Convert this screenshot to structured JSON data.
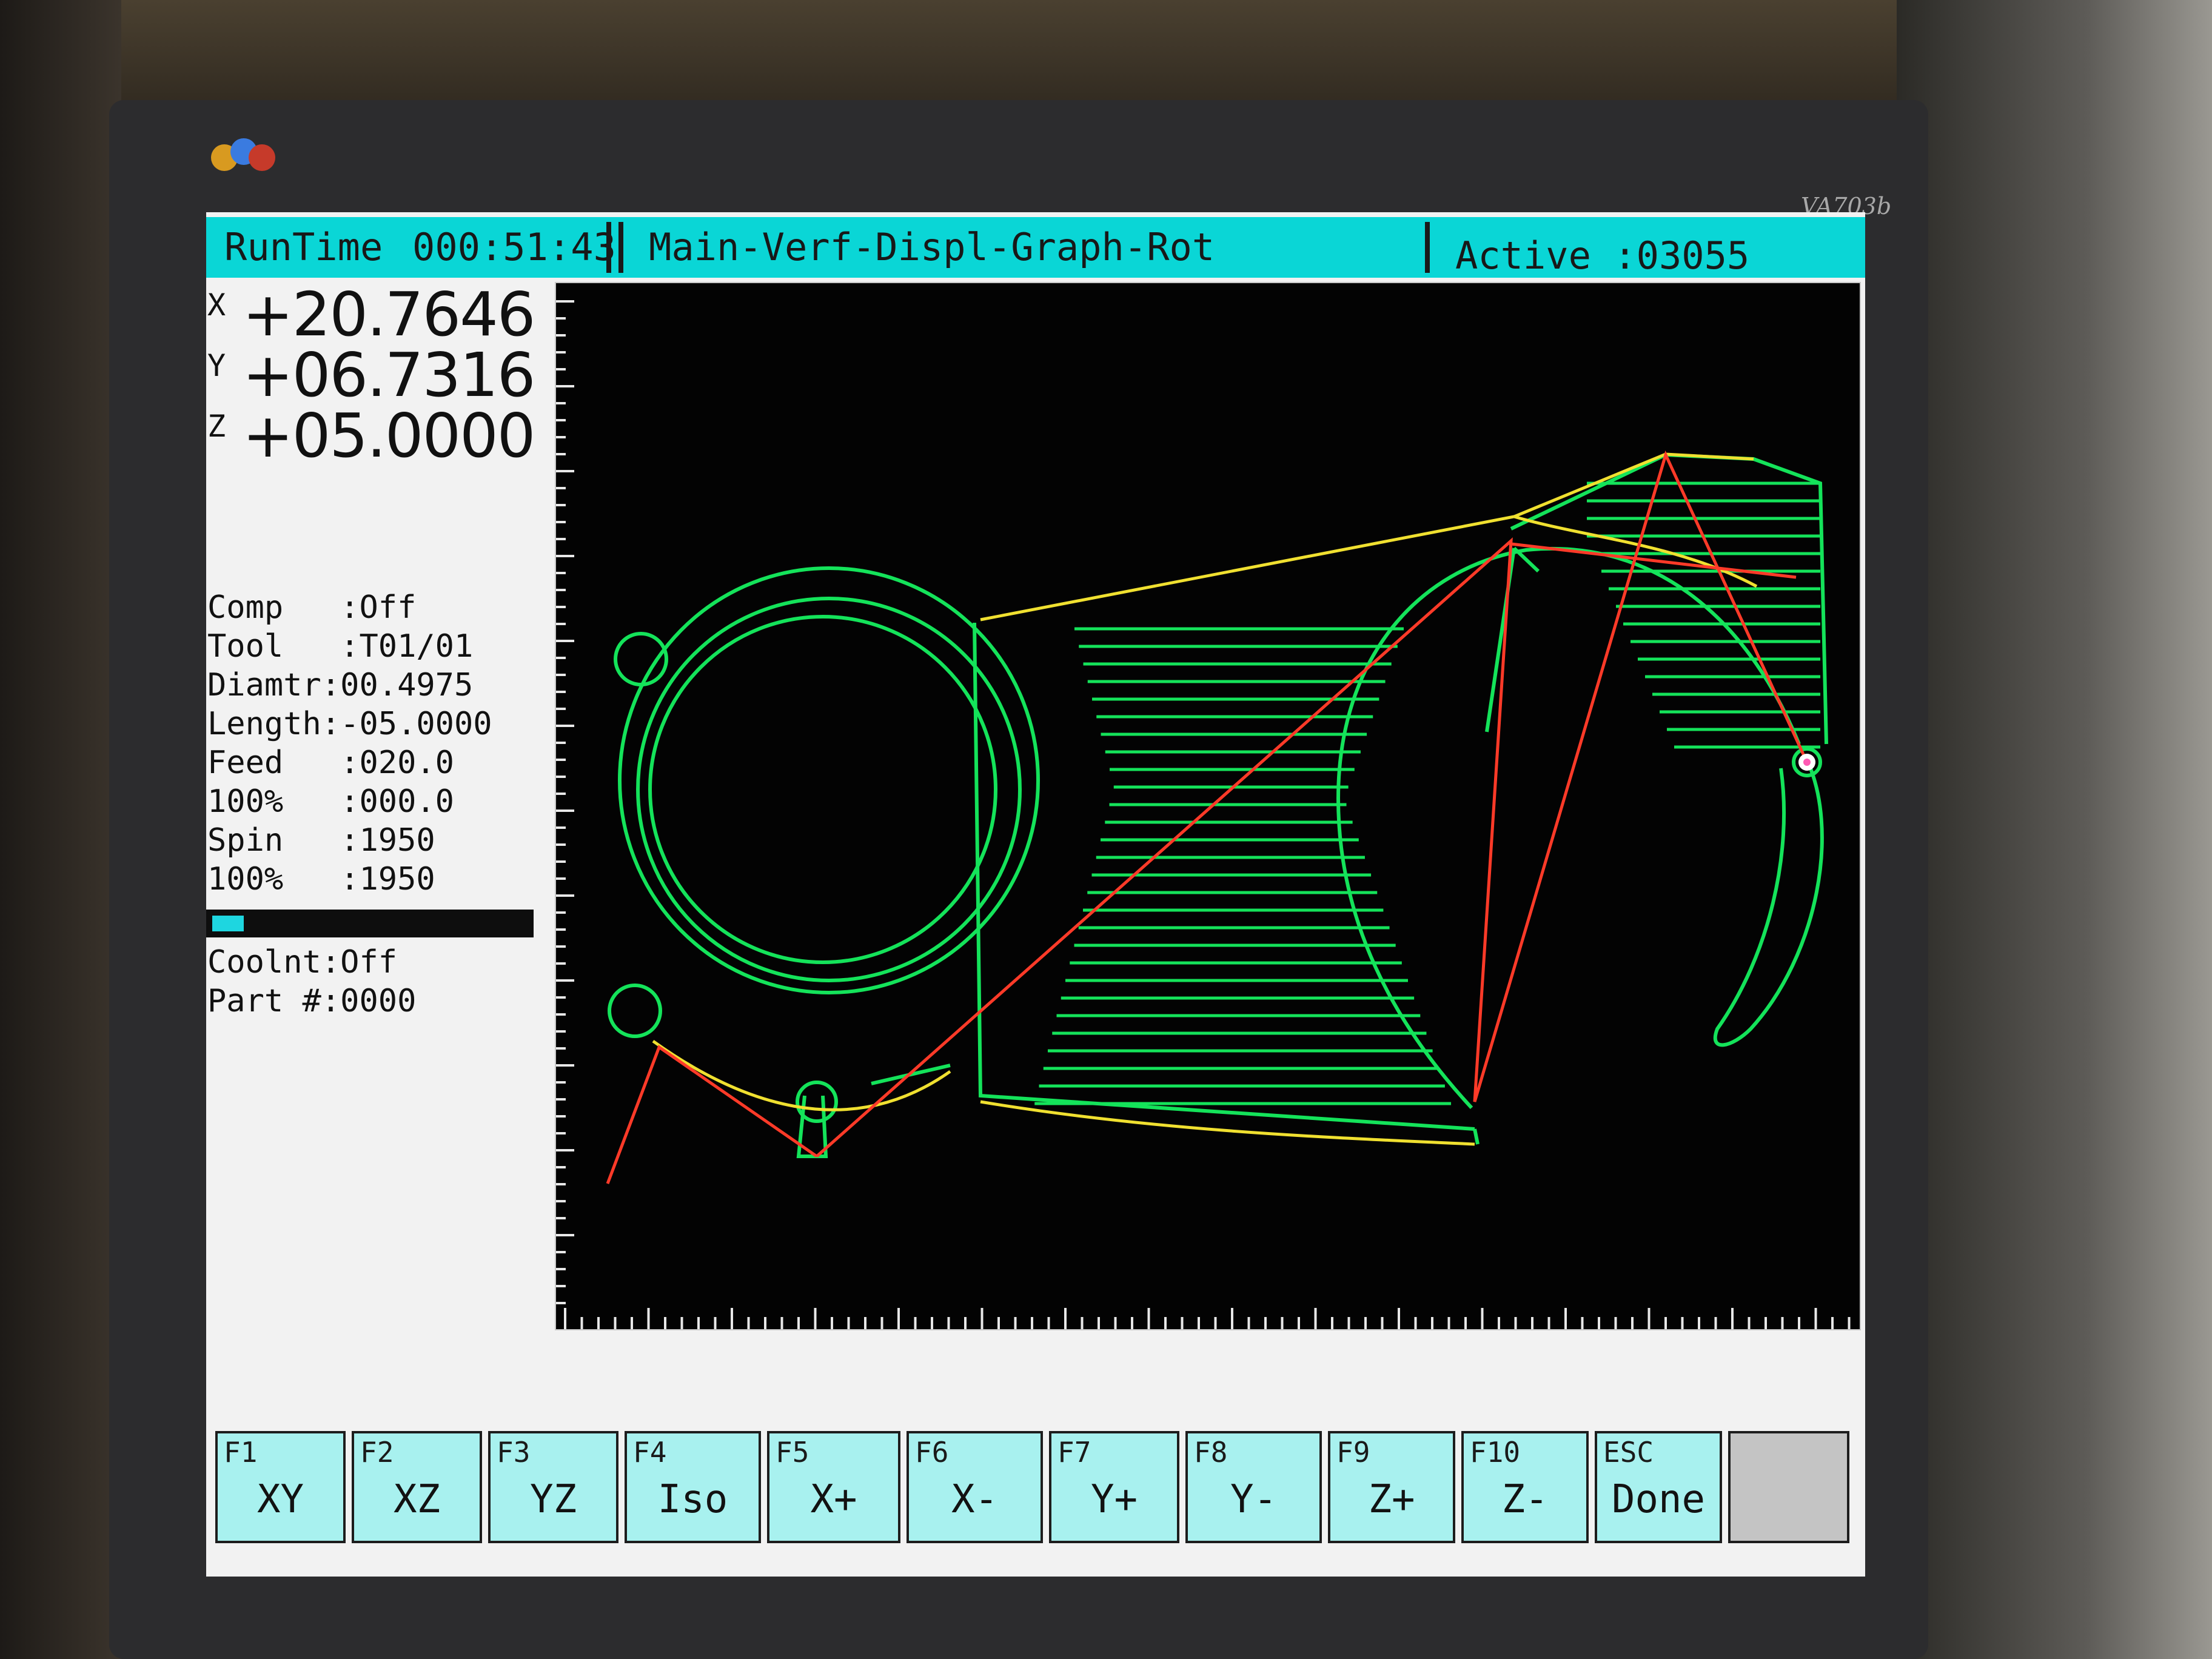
{
  "title_bar": {
    "runtime_label": "RunTime",
    "runtime_value": "000:51:43",
    "menu_path": "Main-Verf-Displ-Graph-Rot",
    "active_label": "Active :03055"
  },
  "coordinates": [
    {
      "axis": "X",
      "value": "+20.7646"
    },
    {
      "axis": "Y",
      "value": "+06.7316"
    },
    {
      "axis": "Z",
      "value": "+05.0000"
    }
  ],
  "parameters": [
    "Comp   :Off",
    "Tool   :T01/01",
    "Diamtr:00.4975",
    "Length:-05.0000",
    "Feed   :020.0",
    "100%   :000.0",
    "Spin   :1950",
    "100%   :1950"
  ],
  "progress_fraction": 0.1,
  "parameters_lower": [
    "Coolnt:Off",
    "Part #:0000"
  ],
  "function_keys": [
    {
      "code": "F1",
      "label": "XY"
    },
    {
      "code": "F2",
      "label": "XZ"
    },
    {
      "code": "F3",
      "label": "YZ"
    },
    {
      "code": "F4",
      "label": "Iso"
    },
    {
      "code": "F5",
      "label": "X+"
    },
    {
      "code": "F6",
      "label": "X-"
    },
    {
      "code": "F7",
      "label": "Y+"
    },
    {
      "code": "F8",
      "label": "Y-"
    },
    {
      "code": "F9",
      "label": "Z+"
    },
    {
      "code": "F10",
      "label": "Z-"
    },
    {
      "code": "ESC",
      "label": "Done"
    }
  ],
  "bezel": {
    "model": "VA703b"
  },
  "colors": {
    "title_bar": "#0ad6d6",
    "function_key": "#a8f1ef",
    "toolpath_green": "#14e35a",
    "toolpath_yellow": "#f0e030",
    "rapid_red": "#ff3a28",
    "graph_background": "#030303"
  }
}
